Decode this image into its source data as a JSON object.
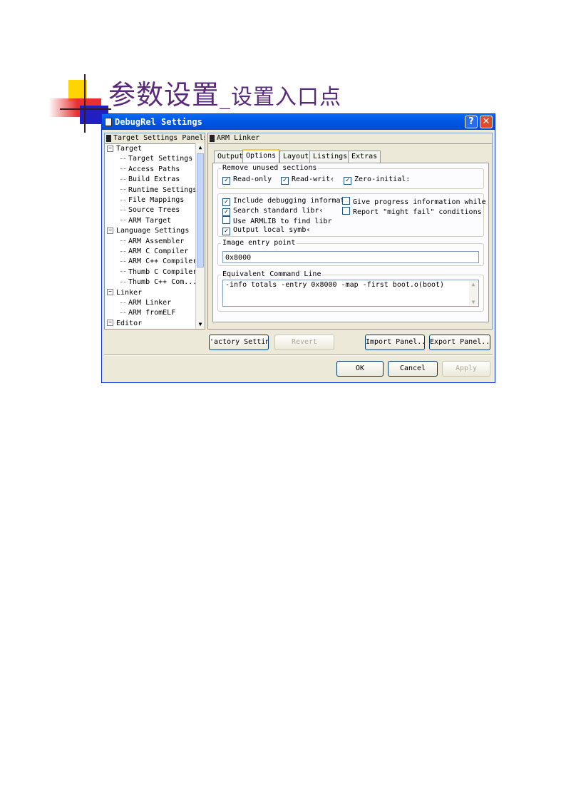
{
  "page": {
    "title_main": "参数设置",
    "title_sub": "_设置入口点"
  },
  "window": {
    "title": "DebugRel Settings",
    "help": "?",
    "close": "✕"
  },
  "tree": {
    "header": "Target Settings Panels",
    "items": [
      {
        "label": "Target",
        "level": 0,
        "expander": "−"
      },
      {
        "label": "Target Settings",
        "level": 1
      },
      {
        "label": "Access Paths",
        "level": 1
      },
      {
        "label": "Build Extras",
        "level": 1
      },
      {
        "label": "Runtime Settings",
        "level": 1
      },
      {
        "label": "File Mappings",
        "level": 1
      },
      {
        "label": "Source Trees",
        "level": 1
      },
      {
        "label": "ARM Target",
        "level": 1
      },
      {
        "label": "Language Settings",
        "level": 0,
        "expander": "−"
      },
      {
        "label": "ARM Assembler",
        "level": 1
      },
      {
        "label": "ARM C Compiler",
        "level": 1
      },
      {
        "label": "ARM C++ Compiler",
        "level": 1
      },
      {
        "label": "Thumb C Compiler",
        "level": 1
      },
      {
        "label": "Thumb C++ Com...",
        "level": 1
      },
      {
        "label": "Linker",
        "level": 0,
        "expander": "−"
      },
      {
        "label": "ARM Linker",
        "level": 1
      },
      {
        "label": "ARM fromELF",
        "level": 1
      },
      {
        "label": "Editor",
        "level": 0,
        "expander": "−"
      }
    ]
  },
  "panel": {
    "header": "ARM Linker",
    "tabs": [
      "Output",
      "Options",
      "Layout",
      "Listings",
      "Extras"
    ],
    "active_tab": "Options",
    "remove_unused": {
      "label": "Remove unused sections",
      "items": [
        {
          "label": "Read-only",
          "checked": true
        },
        {
          "label": "Read-writ‹",
          "checked": true
        },
        {
          "label": "Zero-initial:",
          "checked": true
        }
      ]
    },
    "opts_left": [
      {
        "label": "Include debugging informat",
        "checked": true
      },
      {
        "label": "Search standard libr‹",
        "checked": true
      },
      {
        "label": "Use ARMLIB to find libr",
        "checked": false
      },
      {
        "label": "Output local symb‹",
        "checked": true
      }
    ],
    "opts_right": [
      {
        "label": "Give progress information while",
        "checked": false
      },
      {
        "label": "Report \"might fail\" conditions",
        "checked": false
      }
    ],
    "entry": {
      "label": "Image entry point",
      "value": "0x8000"
    },
    "cmdline": {
      "label": "Equivalent Command Line",
      "value": "-info totals -entry 0x8000 -map -first boot.o(boot)"
    }
  },
  "buttons": {
    "factory": "'actory Setting:",
    "revert": "Revert",
    "import": "Import Panel...",
    "export": "Export Panel...",
    "ok": "OK",
    "cancel": "Cancel",
    "apply": "Apply"
  },
  "icons": {
    "check": "✓",
    "scroll_up": "▲",
    "scroll_down": "▼"
  }
}
